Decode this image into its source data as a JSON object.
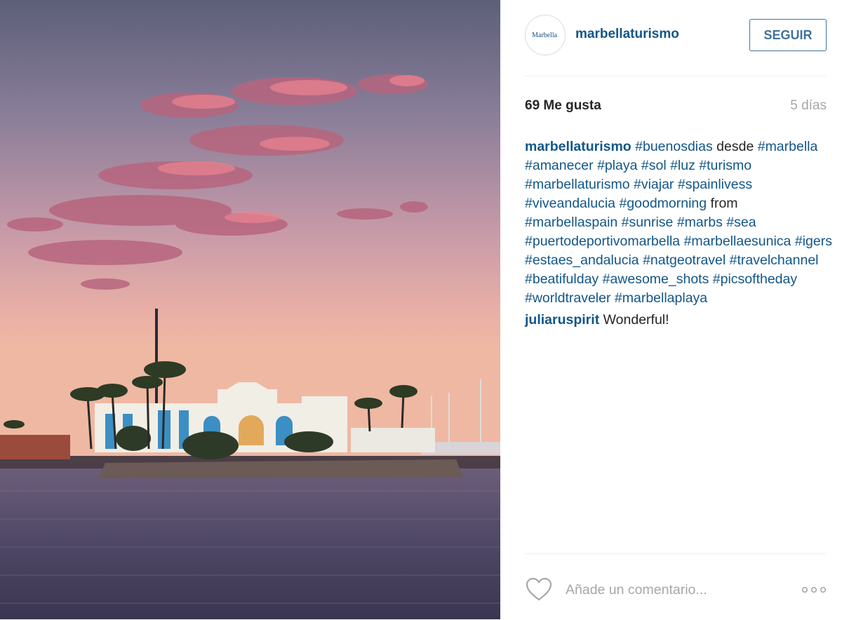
{
  "post": {
    "username": "marbellaturismo",
    "avatar_text": "Marbella",
    "follow_label": "SEGUIR",
    "likes": "69 Me gusta",
    "age": "5 días",
    "caption": {
      "user": "marbellaturismo",
      "segments": [
        {
          "type": "tag",
          "text": "#buenosdias"
        },
        {
          "type": "text",
          "text": "desde"
        },
        {
          "type": "tag",
          "text": "#marbella"
        },
        {
          "type": "tag",
          "text": "#amanecer"
        },
        {
          "type": "tag",
          "text": "#playa"
        },
        {
          "type": "tag",
          "text": "#sol"
        },
        {
          "type": "tag",
          "text": "#luz"
        },
        {
          "type": "tag",
          "text": "#turismo"
        },
        {
          "type": "tag",
          "text": "#marbellaturismo"
        },
        {
          "type": "tag",
          "text": "#viajar"
        },
        {
          "type": "tag",
          "text": "#spainlivess"
        },
        {
          "type": "tag",
          "text": "#viveandalucia"
        },
        {
          "type": "tag",
          "text": "#goodmorning"
        },
        {
          "type": "text",
          "text": "from"
        },
        {
          "type": "tag",
          "text": "#marbellaspain"
        },
        {
          "type": "tag",
          "text": "#sunrise"
        },
        {
          "type": "tag",
          "text": "#marbs"
        },
        {
          "type": "tag",
          "text": "#sea"
        },
        {
          "type": "tag",
          "text": "#puertodeportivomarbella"
        },
        {
          "type": "tag",
          "text": "#marbellaesunica"
        },
        {
          "type": "tag",
          "text": "#igers"
        },
        {
          "type": "tag",
          "text": "#estaes_andalucia"
        },
        {
          "type": "tag",
          "text": "#natgeotravel"
        },
        {
          "type": "tag",
          "text": "#travelchannel"
        },
        {
          "type": "tag",
          "text": "#beatifulday"
        },
        {
          "type": "tag",
          "text": "#awesome_shots"
        },
        {
          "type": "tag",
          "text": "#picsoftheday"
        },
        {
          "type": "tag",
          "text": "#worldtraveler"
        },
        {
          "type": "tag",
          "text": "#marbellaplaya"
        }
      ]
    },
    "comments": [
      {
        "user": "juliaruspirit",
        "text": "Wonderful!"
      }
    ],
    "comment_placeholder": "Añade un comentario...",
    "icons": {
      "like": "heart-icon",
      "more": "more-options-icon"
    }
  },
  "colors": {
    "link": "#125688",
    "follow": "#3f729b",
    "muted": "#a5a7aa",
    "text": "#262626"
  }
}
